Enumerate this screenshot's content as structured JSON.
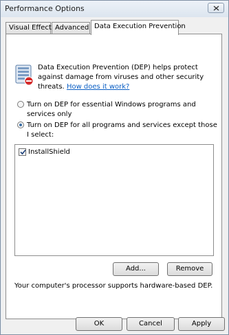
{
  "window": {
    "title": "Performance Options",
    "close_icon": "close-icon"
  },
  "tabs": [
    {
      "label": "Visual Effects",
      "active": false
    },
    {
      "label": "Advanced",
      "active": false
    },
    {
      "label": "Data Execution Prevention",
      "active": true
    }
  ],
  "dep": {
    "icon": "dep-shield-icon",
    "description": "Data Execution Prevention (DEP) helps protect against damage from viruses and other security threats.",
    "help_link": "How does it work?",
    "option_essential": "Turn on DEP for essential Windows programs and services only",
    "option_all": "Turn on DEP for all programs and services except those I select:",
    "selected_option": "option_all",
    "exceptions": [
      {
        "label": "InstallShield",
        "checked": true
      }
    ],
    "add_label": "Add...",
    "remove_label": "Remove",
    "hardware_status": "Your computer's processor supports hardware-based DEP."
  },
  "footer": {
    "ok_label": "OK",
    "cancel_label": "Cancel",
    "apply_label": "Apply"
  }
}
